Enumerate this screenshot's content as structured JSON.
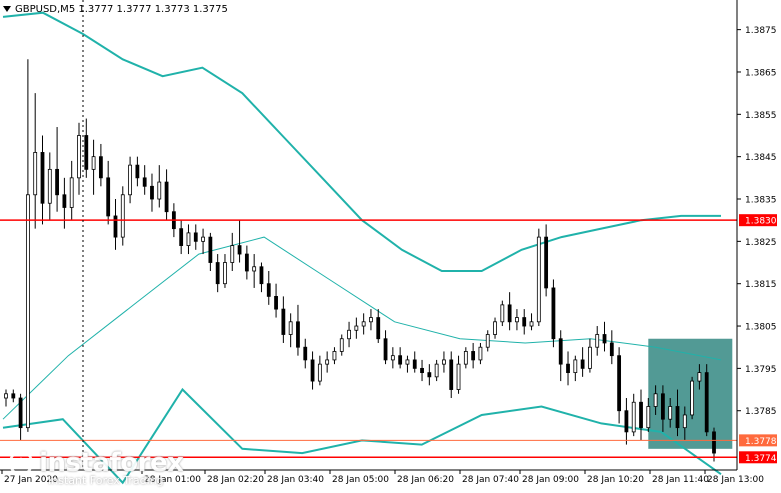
{
  "header": {
    "symbol_line": "GBPUSD,M5  1.3777 1.3777 1.3773 1.3775"
  },
  "watermark": {
    "brand": "instaforex",
    "tagline": "Instant Forex Trading"
  },
  "colors": {
    "background": "#ffffff",
    "candles": "#000000",
    "bollinger": "#20b2aa",
    "level_line": "#ff0000",
    "level_line_secondary": "#ff6a3d",
    "zone_fill": "#3f8f8a",
    "label_bg": "#ff0000",
    "label_bg_secondary": "#ff6a3d"
  },
  "chart_data": {
    "type": "candlestick",
    "symbol": "GBPUSD",
    "timeframe": "M5",
    "ylim": [
      1.3771,
      1.3882
    ],
    "y_ticks": [
      "1.3875",
      "1.3865",
      "1.3855",
      "1.3845",
      "1.3835",
      "1.3825",
      "1.3815",
      "1.3805",
      "1.3795",
      "1.3785"
    ],
    "x_ticks": [
      "27 Jan 2020",
      "28 Jan 01:00",
      "28 Jan 02:20",
      "28 Jan 03:40",
      "28 Jan 05:00",
      "28 Jan 06:20",
      "28 Jan 07:40",
      "28 Jan 09:00",
      "28 Jan 10:20",
      "28 Jan 11:40",
      "28 Jan 13:00"
    ],
    "levels": [
      {
        "label": "1.3830",
        "value": 1.383,
        "style": "primary"
      },
      {
        "label": "1.3778",
        "value": 1.3778,
        "style": "secondary"
      },
      {
        "label": "1.3774",
        "value": 1.3774,
        "style": "primary"
      }
    ],
    "upper_band": [
      1.3878,
      1.3879,
      1.3874,
      1.3868,
      1.3864,
      1.3866,
      1.386,
      1.385,
      1.384,
      1.383,
      1.3823,
      1.3818,
      1.3818,
      1.3823,
      1.3826,
      1.3828,
      1.383,
      1.3831,
      1.3831
    ],
    "middle_band": [
      1.3783,
      1.3798,
      1.381,
      1.3822,
      1.3826,
      1.3816,
      1.3806,
      1.3802,
      1.3801,
      1.3802,
      1.38,
      1.3797
    ],
    "lower_band": [
      1.3781,
      1.3783,
      1.3768,
      1.379,
      1.3776,
      1.3775,
      1.3778,
      1.3777,
      1.3784,
      1.3786,
      1.3782,
      1.378,
      1.377
    ],
    "candles": [
      {
        "o": 1.3788,
        "h": 1.379,
        "l": 1.3786,
        "c": 1.3789
      },
      {
        "o": 1.3789,
        "h": 1.379,
        "l": 1.3787,
        "c": 1.3788
      },
      {
        "o": 1.3788,
        "h": 1.3789,
        "l": 1.3778,
        "c": 1.3781
      },
      {
        "o": 1.3781,
        "h": 1.3868,
        "l": 1.378,
        "c": 1.3836
      },
      {
        "o": 1.3836,
        "h": 1.386,
        "l": 1.3828,
        "c": 1.3846
      },
      {
        "o": 1.3846,
        "h": 1.385,
        "l": 1.3829,
        "c": 1.3834
      },
      {
        "o": 1.3834,
        "h": 1.3846,
        "l": 1.383,
        "c": 1.3842
      },
      {
        "o": 1.3842,
        "h": 1.3852,
        "l": 1.3832,
        "c": 1.3836
      },
      {
        "o": 1.3836,
        "h": 1.384,
        "l": 1.3828,
        "c": 1.3833
      },
      {
        "o": 1.3833,
        "h": 1.3844,
        "l": 1.383,
        "c": 1.384
      },
      {
        "o": 1.384,
        "h": 1.3853,
        "l": 1.3836,
        "c": 1.385
      },
      {
        "o": 1.385,
        "h": 1.3854,
        "l": 1.384,
        "c": 1.3842
      },
      {
        "o": 1.3842,
        "h": 1.3849,
        "l": 1.3836,
        "c": 1.3845
      },
      {
        "o": 1.3845,
        "h": 1.3848,
        "l": 1.3838,
        "c": 1.384
      },
      {
        "o": 1.384,
        "h": 1.3844,
        "l": 1.3829,
        "c": 1.3831
      },
      {
        "o": 1.3831,
        "h": 1.3835,
        "l": 1.3823,
        "c": 1.3826
      },
      {
        "o": 1.3826,
        "h": 1.3838,
        "l": 1.3824,
        "c": 1.3836
      },
      {
        "o": 1.3836,
        "h": 1.3845,
        "l": 1.3834,
        "c": 1.3843
      },
      {
        "o": 1.3843,
        "h": 1.3845,
        "l": 1.3838,
        "c": 1.384
      },
      {
        "o": 1.384,
        "h": 1.3843,
        "l": 1.3836,
        "c": 1.3838
      },
      {
        "o": 1.3838,
        "h": 1.3841,
        "l": 1.3832,
        "c": 1.3835
      },
      {
        "o": 1.3835,
        "h": 1.3843,
        "l": 1.3833,
        "c": 1.3839
      },
      {
        "o": 1.3839,
        "h": 1.3842,
        "l": 1.383,
        "c": 1.3832
      },
      {
        "o": 1.3832,
        "h": 1.3834,
        "l": 1.3826,
        "c": 1.3828
      },
      {
        "o": 1.3828,
        "h": 1.383,
        "l": 1.3822,
        "c": 1.3824
      },
      {
        "o": 1.3824,
        "h": 1.3829,
        "l": 1.3822,
        "c": 1.3827
      },
      {
        "o": 1.3827,
        "h": 1.3829,
        "l": 1.3823,
        "c": 1.3825
      },
      {
        "o": 1.3825,
        "h": 1.3828,
        "l": 1.3822,
        "c": 1.3826
      },
      {
        "o": 1.3826,
        "h": 1.3827,
        "l": 1.3818,
        "c": 1.382
      },
      {
        "o": 1.382,
        "h": 1.3822,
        "l": 1.3813,
        "c": 1.3815
      },
      {
        "o": 1.3815,
        "h": 1.3822,
        "l": 1.3814,
        "c": 1.382
      },
      {
        "o": 1.382,
        "h": 1.3827,
        "l": 1.3818,
        "c": 1.3824
      },
      {
        "o": 1.3824,
        "h": 1.383,
        "l": 1.382,
        "c": 1.3822
      },
      {
        "o": 1.3822,
        "h": 1.3824,
        "l": 1.3816,
        "c": 1.3818
      },
      {
        "o": 1.3818,
        "h": 1.3822,
        "l": 1.3814,
        "c": 1.3819
      },
      {
        "o": 1.3819,
        "h": 1.382,
        "l": 1.3813,
        "c": 1.3815
      },
      {
        "o": 1.3815,
        "h": 1.3818,
        "l": 1.381,
        "c": 1.3812
      },
      {
        "o": 1.3812,
        "h": 1.3815,
        "l": 1.3807,
        "c": 1.3809
      },
      {
        "o": 1.3809,
        "h": 1.3812,
        "l": 1.3801,
        "c": 1.3803
      },
      {
        "o": 1.3803,
        "h": 1.3808,
        "l": 1.38,
        "c": 1.3806
      },
      {
        "o": 1.3806,
        "h": 1.381,
        "l": 1.3798,
        "c": 1.38
      },
      {
        "o": 1.38,
        "h": 1.3802,
        "l": 1.3795,
        "c": 1.3797
      },
      {
        "o": 1.3797,
        "h": 1.3799,
        "l": 1.379,
        "c": 1.3792
      },
      {
        "o": 1.3792,
        "h": 1.3798,
        "l": 1.3791,
        "c": 1.3796
      },
      {
        "o": 1.3796,
        "h": 1.3799,
        "l": 1.3794,
        "c": 1.3797
      },
      {
        "o": 1.3797,
        "h": 1.38,
        "l": 1.3796,
        "c": 1.3799
      },
      {
        "o": 1.3799,
        "h": 1.3803,
        "l": 1.3798,
        "c": 1.3802
      },
      {
        "o": 1.3802,
        "h": 1.3806,
        "l": 1.38,
        "c": 1.3804
      },
      {
        "o": 1.3804,
        "h": 1.3807,
        "l": 1.3802,
        "c": 1.3805
      },
      {
        "o": 1.3805,
        "h": 1.3808,
        "l": 1.3803,
        "c": 1.3806
      },
      {
        "o": 1.3806,
        "h": 1.3809,
        "l": 1.3804,
        "c": 1.3807
      },
      {
        "o": 1.3807,
        "h": 1.3809,
        "l": 1.3801,
        "c": 1.3802
      },
      {
        "o": 1.3802,
        "h": 1.3804,
        "l": 1.3796,
        "c": 1.3797
      },
      {
        "o": 1.3797,
        "h": 1.38,
        "l": 1.3795,
        "c": 1.3798
      },
      {
        "o": 1.3798,
        "h": 1.38,
        "l": 1.3795,
        "c": 1.3796
      },
      {
        "o": 1.3796,
        "h": 1.3798,
        "l": 1.3794,
        "c": 1.3797
      },
      {
        "o": 1.3797,
        "h": 1.3799,
        "l": 1.3794,
        "c": 1.3795
      },
      {
        "o": 1.3795,
        "h": 1.3797,
        "l": 1.3792,
        "c": 1.3794
      },
      {
        "o": 1.3794,
        "h": 1.3796,
        "l": 1.3791,
        "c": 1.3793
      },
      {
        "o": 1.3793,
        "h": 1.3797,
        "l": 1.3792,
        "c": 1.3796
      },
      {
        "o": 1.3796,
        "h": 1.3799,
        "l": 1.3794,
        "c": 1.3797
      },
      {
        "o": 1.3797,
        "h": 1.3799,
        "l": 1.3788,
        "c": 1.379
      },
      {
        "o": 1.379,
        "h": 1.3798,
        "l": 1.3789,
        "c": 1.3796
      },
      {
        "o": 1.3796,
        "h": 1.38,
        "l": 1.3795,
        "c": 1.3799
      },
      {
        "o": 1.3799,
        "h": 1.3801,
        "l": 1.3795,
        "c": 1.3797
      },
      {
        "o": 1.3797,
        "h": 1.3801,
        "l": 1.3796,
        "c": 1.38
      },
      {
        "o": 1.38,
        "h": 1.3804,
        "l": 1.3799,
        "c": 1.3803
      },
      {
        "o": 1.3803,
        "h": 1.3807,
        "l": 1.3802,
        "c": 1.3806
      },
      {
        "o": 1.3806,
        "h": 1.3811,
        "l": 1.3805,
        "c": 1.381
      },
      {
        "o": 1.381,
        "h": 1.3813,
        "l": 1.3804,
        "c": 1.3806
      },
      {
        "o": 1.3806,
        "h": 1.3809,
        "l": 1.3804,
        "c": 1.3807
      },
      {
        "o": 1.3807,
        "h": 1.3809,
        "l": 1.3803,
        "c": 1.3805
      },
      {
        "o": 1.3805,
        "h": 1.3808,
        "l": 1.3804,
        "c": 1.3806
      },
      {
        "o": 1.3806,
        "h": 1.3828,
        "l": 1.3805,
        "c": 1.3826
      },
      {
        "o": 1.3826,
        "h": 1.3829,
        "l": 1.3812,
        "c": 1.3814
      },
      {
        "o": 1.3814,
        "h": 1.3816,
        "l": 1.38,
        "c": 1.3802
      },
      {
        "o": 1.3802,
        "h": 1.3804,
        "l": 1.3792,
        "c": 1.3796
      },
      {
        "o": 1.3796,
        "h": 1.3799,
        "l": 1.3791,
        "c": 1.3794
      },
      {
        "o": 1.3794,
        "h": 1.3798,
        "l": 1.3792,
        "c": 1.3797
      },
      {
        "o": 1.3797,
        "h": 1.38,
        "l": 1.3793,
        "c": 1.3795
      },
      {
        "o": 1.3795,
        "h": 1.3802,
        "l": 1.3794,
        "c": 1.38
      },
      {
        "o": 1.38,
        "h": 1.3805,
        "l": 1.3798,
        "c": 1.3803
      },
      {
        "o": 1.3803,
        "h": 1.3806,
        "l": 1.3799,
        "c": 1.3801
      },
      {
        "o": 1.3801,
        "h": 1.3804,
        "l": 1.3796,
        "c": 1.3798
      },
      {
        "o": 1.3798,
        "h": 1.38,
        "l": 1.3782,
        "c": 1.3785
      },
      {
        "o": 1.3785,
        "h": 1.3788,
        "l": 1.3777,
        "c": 1.378
      },
      {
        "o": 1.378,
        "h": 1.3789,
        "l": 1.3779,
        "c": 1.3787
      },
      {
        "o": 1.3787,
        "h": 1.379,
        "l": 1.3778,
        "c": 1.3781
      },
      {
        "o": 1.3781,
        "h": 1.3788,
        "l": 1.378,
        "c": 1.3786
      },
      {
        "o": 1.3786,
        "h": 1.3791,
        "l": 1.3784,
        "c": 1.3789
      },
      {
        "o": 1.3789,
        "h": 1.3791,
        "l": 1.378,
        "c": 1.3783
      },
      {
        "o": 1.3783,
        "h": 1.3788,
        "l": 1.3781,
        "c": 1.3786
      },
      {
        "o": 1.3786,
        "h": 1.379,
        "l": 1.3779,
        "c": 1.3781
      },
      {
        "o": 1.3781,
        "h": 1.3786,
        "l": 1.3778,
        "c": 1.3784
      },
      {
        "o": 1.3784,
        "h": 1.3793,
        "l": 1.3783,
        "c": 1.3792
      },
      {
        "o": 1.3792,
        "h": 1.3796,
        "l": 1.379,
        "c": 1.3794
      },
      {
        "o": 1.3794,
        "h": 1.3796,
        "l": 1.3779,
        "c": 1.378
      },
      {
        "o": 1.378,
        "h": 1.3781,
        "l": 1.3773,
        "c": 1.3775
      }
    ]
  }
}
